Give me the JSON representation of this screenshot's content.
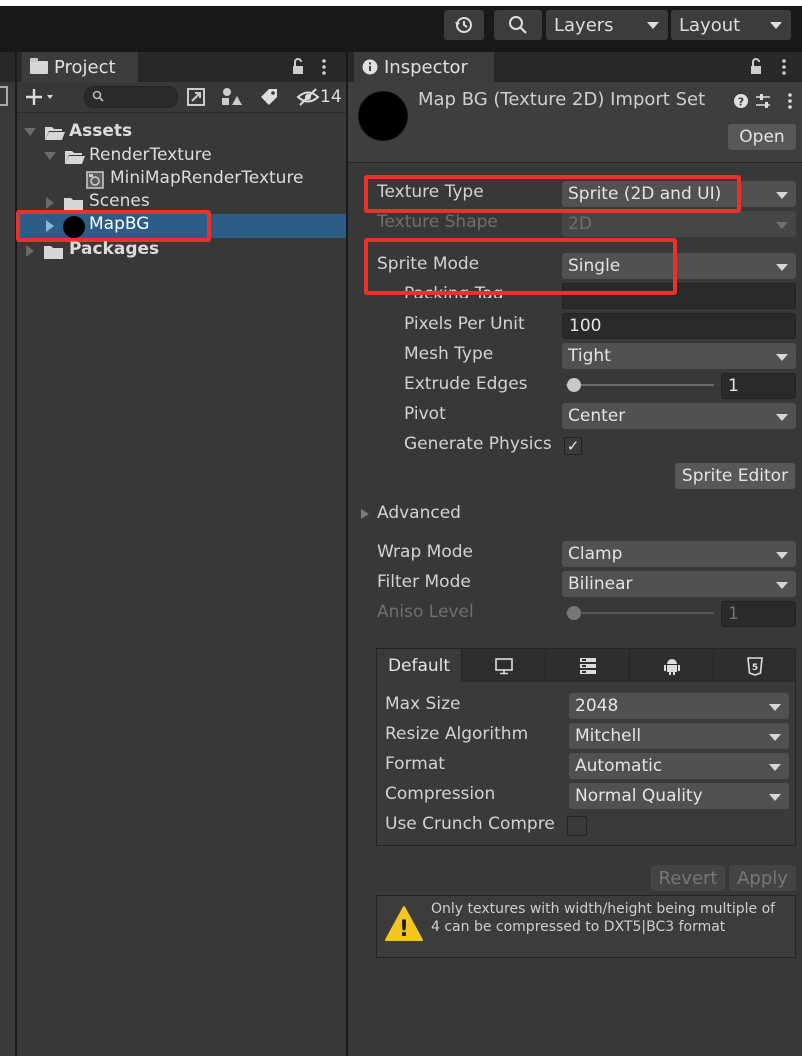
{
  "toolbar": {
    "history_icon": "history-icon",
    "search_icon": "search-icon",
    "layers_label": "Layers",
    "layout_label": "Layout"
  },
  "project": {
    "tab_label": "Project",
    "hidden_count": "14",
    "tree": {
      "assets": "Assets",
      "render_texture": "RenderTexture",
      "minimap_rt": "MiniMapRenderTexture",
      "scenes": "Scenes",
      "mapbg": "MapBG",
      "packages": "Packages"
    }
  },
  "inspector": {
    "tab_label": "Inspector",
    "title": "Map BG (Texture 2D) Import Set",
    "open_label": "Open",
    "texture_type": {
      "label": "Texture Type",
      "value": "Sprite (2D and UI)"
    },
    "texture_shape": {
      "label": "Texture Shape",
      "value": "2D"
    },
    "sprite_mode": {
      "label": "Sprite Mode",
      "value": "Single"
    },
    "packing_tag": {
      "label": "Packing Tag",
      "value": ""
    },
    "pixels_per_unit": {
      "label": "Pixels Per Unit",
      "value": "100"
    },
    "mesh_type": {
      "label": "Mesh Type",
      "value": "Tight"
    },
    "extrude_edges": {
      "label": "Extrude Edges",
      "value": "1"
    },
    "pivot": {
      "label": "Pivot",
      "value": "Center"
    },
    "generate_physics": {
      "label": "Generate Physics",
      "checked": true,
      "mark": "✓"
    },
    "sprite_editor_label": "Sprite Editor",
    "advanced_label": "Advanced",
    "wrap_mode": {
      "label": "Wrap Mode",
      "value": "Clamp"
    },
    "filter_mode": {
      "label": "Filter Mode",
      "value": "Bilinear"
    },
    "aniso_level": {
      "label": "Aniso Level",
      "value": "1"
    },
    "platform_tabs": {
      "default_label": "Default",
      "icons": [
        "monitor-icon",
        "server-icon",
        "android-icon",
        "html5-icon"
      ],
      "html5_glyph": "5"
    },
    "max_size": {
      "label": "Max Size",
      "value": "2048"
    },
    "resize_algorithm": {
      "label": "Resize Algorithm",
      "value": "Mitchell"
    },
    "format": {
      "label": "Format",
      "value": "Automatic"
    },
    "compression": {
      "label": "Compression",
      "value": "Normal Quality"
    },
    "use_crunch": {
      "label": "Use Crunch Compre",
      "checked": false
    },
    "revert_label": "Revert",
    "apply_label": "Apply",
    "warning_line1": "Only textures with width/height being multiple of",
    "warning_line2": "4 can be compressed to DXT5|BC3 format",
    "warning_mark": "!"
  },
  "colors": {
    "highlight_box": "#e8322c",
    "selection": "#2c5d87",
    "panel": "#383838",
    "warning_icon": "#f2c522"
  }
}
